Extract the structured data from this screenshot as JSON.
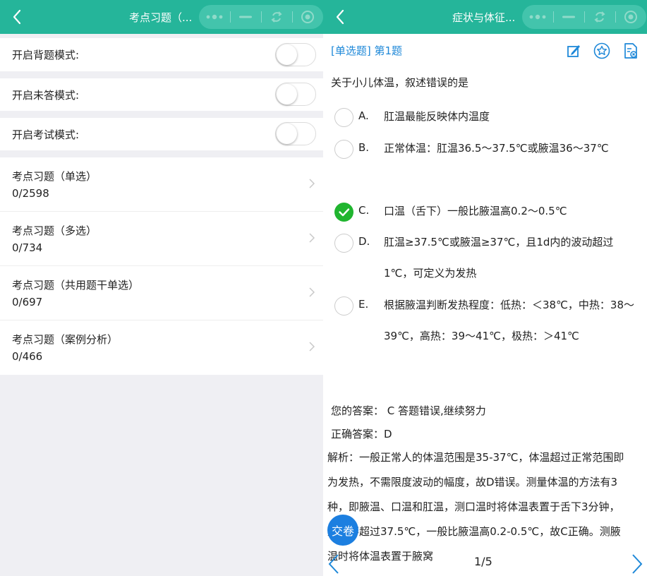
{
  "colors": {
    "header": "#25b59a",
    "link": "#1e88d8",
    "check": "#20b52f",
    "submit": "#1c7fe0"
  },
  "left": {
    "title": "考点习题（...",
    "back_icon": "chevron-left-icon",
    "toggles": [
      {
        "label": "开启背题模式:",
        "on": false
      },
      {
        "label": "开启未答模式:",
        "on": false
      },
      {
        "label": "开启考试模式:",
        "on": false
      }
    ],
    "sets": [
      {
        "title": "考点习题（单选）",
        "count": "0/2598"
      },
      {
        "title": "考点习题（多选）",
        "count": "0/734"
      },
      {
        "title": "考点习题（共用题干单选）",
        "count": "0/697"
      },
      {
        "title": "考点习题（案例分析）",
        "count": "0/466"
      }
    ]
  },
  "right": {
    "title": "症状与体征...",
    "question_type": "[单选题] 第1题",
    "toolbar_icons": [
      "edit-icon",
      "star-icon",
      "answer-card-icon"
    ],
    "question": "关于小儿体温，叙述错误的是",
    "options": [
      {
        "letter": "A.",
        "text": "肛温最能反映体内温度",
        "checked": false
      },
      {
        "letter": "B.",
        "text": "正常体温：肛温36.5～37.5℃或腋温36～37℃",
        "checked": false
      },
      {
        "letter": "C.",
        "text": "口温（舌下）一般比腋温高0.2～0.5℃",
        "checked": true
      },
      {
        "letter": "D.",
        "text": "肛温≥37.5℃或腋温≥37℃，且1d内的波动超过1℃，可定义为发热",
        "checked": false
      },
      {
        "letter": "E.",
        "text": "根据腋温判断发热程度：低热：＜38℃，中热：38～39℃，高热：39～41℃，极热：＞41℃",
        "checked": false
      }
    ],
    "your_answer": "您的答案：  C 答题错误,继续努力",
    "correct_answer": "正确答案：D",
    "analysis": "解析：一般正常人的体温范围是35-37℃，体温超过正常范围即为发热，不需限度波动的幅度，故D错误。测量体温的方法有3种，即腋温、口温和肛温，测口温时将体温表置于舌下3分钟，正常不超过37.5℃，一般比腋温高0.2-0.5℃，故C正确。测腋温时将体温表置于腋窝",
    "submit_label": "交卷",
    "page": "1/5"
  }
}
